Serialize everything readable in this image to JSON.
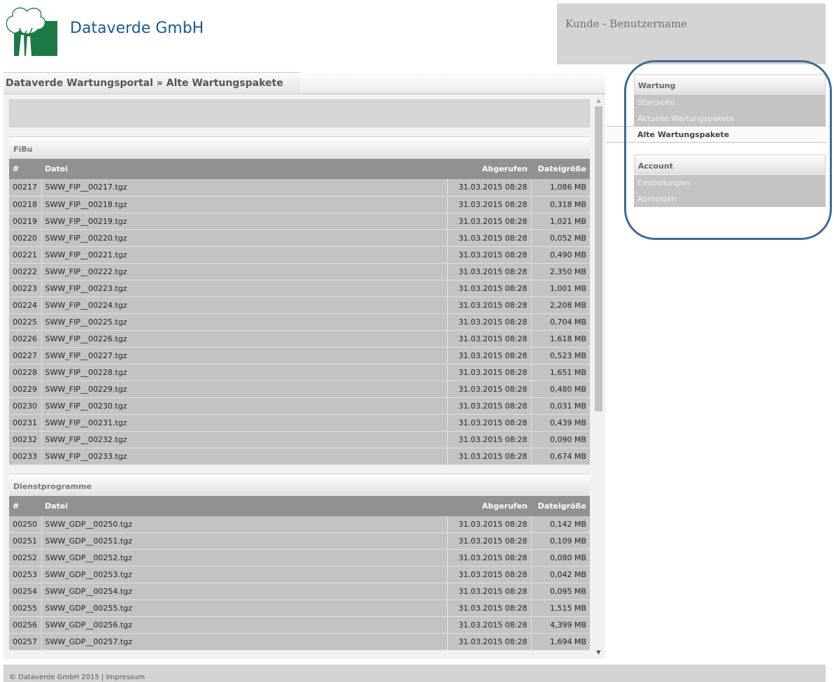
{
  "header": {
    "company": "Dataverde GmbH",
    "user_label": "Kunde - Benutzername"
  },
  "breadcrumb": "Dataverde Wartungsportal » Alte Wartungspakete",
  "columns": {
    "num": "#",
    "file": "Datei",
    "retrieved": "Abgerufen",
    "size": "Dateigröße"
  },
  "sections": [
    {
      "title": "FiBu",
      "rows": [
        {
          "num": "00217",
          "file": "SWW_FIP__00217.tgz",
          "date": "31.03.2015 08:28",
          "size": "1,086 MB"
        },
        {
          "num": "00218",
          "file": "SWW_FIP__00218.tgz",
          "date": "31.03.2015 08:28",
          "size": "0,318 MB"
        },
        {
          "num": "00219",
          "file": "SWW_FIP__00219.tgz",
          "date": "31.03.2015 08:28",
          "size": "1,021 MB"
        },
        {
          "num": "00220",
          "file": "SWW_FIP__00220.tgz",
          "date": "31.03.2015 08:28",
          "size": "0,052 MB"
        },
        {
          "num": "00221",
          "file": "SWW_FIP__00221.tgz",
          "date": "31.03.2015 08:28",
          "size": "0,490 MB"
        },
        {
          "num": "00222",
          "file": "SWW_FIP__00222.tgz",
          "date": "31.03.2015 08:28",
          "size": "2,350 MB"
        },
        {
          "num": "00223",
          "file": "SWW_FIP__00223.tgz",
          "date": "31.03.2015 08:28",
          "size": "1,001 MB"
        },
        {
          "num": "00224",
          "file": "SWW_FIP__00224.tgz",
          "date": "31.03.2015 08:28",
          "size": "2,208 MB"
        },
        {
          "num": "00225",
          "file": "SWW_FIP__00225.tgz",
          "date": "31.03.2015 08:28",
          "size": "0,704 MB"
        },
        {
          "num": "00226",
          "file": "SWW_FIP__00226.tgz",
          "date": "31.03.2015 08:28",
          "size": "1,618 MB"
        },
        {
          "num": "00227",
          "file": "SWW_FIP__00227.tgz",
          "date": "31.03.2015 08:28",
          "size": "0,523 MB"
        },
        {
          "num": "00228",
          "file": "SWW_FIP__00228.tgz",
          "date": "31.03.2015 08:28",
          "size": "1,651 MB"
        },
        {
          "num": "00229",
          "file": "SWW_FIP__00229.tgz",
          "date": "31.03.2015 08:28",
          "size": "0,480 MB"
        },
        {
          "num": "00230",
          "file": "SWW_FIP__00230.tgz",
          "date": "31.03.2015 08:28",
          "size": "0,031 MB"
        },
        {
          "num": "00231",
          "file": "SWW_FIP__00231.tgz",
          "date": "31.03.2015 08:28",
          "size": "0,439 MB"
        },
        {
          "num": "00232",
          "file": "SWW_FIP__00232.tgz",
          "date": "31.03.2015 08:28",
          "size": "0,090 MB"
        },
        {
          "num": "00233",
          "file": "SWW_FIP__00233.tgz",
          "date": "31.03.2015 08:28",
          "size": "0,674 MB"
        }
      ]
    },
    {
      "title": "Dienstprogramme",
      "rows": [
        {
          "num": "00250",
          "file": "SWW_GDP__00250.tgz",
          "date": "31.03.2015 08:28",
          "size": "0,142 MB"
        },
        {
          "num": "00251",
          "file": "SWW_GDP__00251.tgz",
          "date": "31.03.2015 08:28",
          "size": "0,109 MB"
        },
        {
          "num": "00252",
          "file": "SWW_GDP__00252.tgz",
          "date": "31.03.2015 08:28",
          "size": "0,080 MB"
        },
        {
          "num": "00253",
          "file": "SWW_GDP__00253.tgz",
          "date": "31.03.2015 08:28",
          "size": "0,042 MB"
        },
        {
          "num": "00254",
          "file": "SWW_GDP__00254.tgz",
          "date": "31.03.2015 08:28",
          "size": "0,095 MB"
        },
        {
          "num": "00255",
          "file": "SWW_GDP__00255.tgz",
          "date": "31.03.2015 08:28",
          "size": "1,515 MB"
        },
        {
          "num": "00256",
          "file": "SWW_GDP__00256.tgz",
          "date": "31.03.2015 08:28",
          "size": "4,399 MB"
        },
        {
          "num": "00257",
          "file": "SWW_GDP__00257.tgz",
          "date": "31.03.2015 08:28",
          "size": "1,694 MB"
        }
      ]
    }
  ],
  "sidebar": {
    "wartung": {
      "title": "Wartung",
      "items": [
        "Startseite",
        "Aktuelle Wartungspakete",
        "Alte Wartungspakete"
      ],
      "active": "Alte Wartungspakete"
    },
    "account": {
      "title": "Account",
      "items": [
        "Einstellungen",
        "Abmelden"
      ]
    }
  },
  "footer": {
    "copyright": "© Dataverde GmbH 2015",
    "separator": "|",
    "impressum": "Impressum"
  },
  "colors": {
    "brand": "#1a5a8a",
    "logo_green": "#1d7a46",
    "highlight_oval": "#3e6a96",
    "table_header": "#919191",
    "table_row": "#c3c3c3"
  },
  "scroll_position": 0
}
